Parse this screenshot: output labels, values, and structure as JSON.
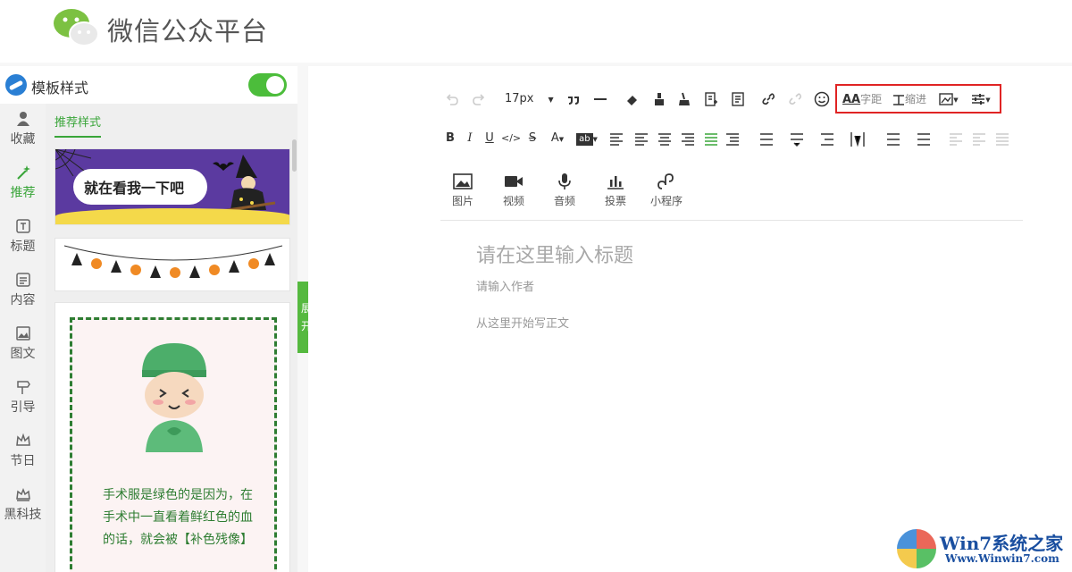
{
  "header": {
    "title": "微信公众平台"
  },
  "left_panel": {
    "title": "模板样式",
    "toggle_on": true,
    "nav": [
      {
        "label": "收藏",
        "icon": "user-icon"
      },
      {
        "label": "推荐",
        "icon": "magic-wand-icon",
        "active": true
      },
      {
        "label": "标题",
        "icon": "title-t-icon"
      },
      {
        "label": "内容",
        "icon": "content-doc-icon"
      },
      {
        "label": "图文",
        "icon": "image-text-icon"
      },
      {
        "label": "引导",
        "icon": "signpost-icon"
      },
      {
        "label": "节日",
        "icon": "crown-icon"
      },
      {
        "label": "黑科技",
        "icon": "crown-alt-icon"
      }
    ],
    "tab": "推荐样式",
    "card1_text": "就在看我一下吧",
    "card3_text": "手术服是绿色的是因为，在手术中一直看着鲜红色的血的话，就会被【补色残像】",
    "expand": "展开"
  },
  "toolbar": {
    "font_size": "17px",
    "letter_spacing": "字距",
    "indent": "缩进"
  },
  "media": [
    {
      "label": "图片",
      "icon": "image-icon"
    },
    {
      "label": "视频",
      "icon": "video-icon"
    },
    {
      "label": "音频",
      "icon": "microphone-icon"
    },
    {
      "label": "投票",
      "icon": "vote-chart-icon"
    },
    {
      "label": "小程序",
      "icon": "mini-program-icon"
    }
  ],
  "editor": {
    "title_placeholder": "请在这里输入标题",
    "author_placeholder": "请输入作者",
    "body_placeholder": "从这里开始写正文"
  },
  "watermark": {
    "title": "Win7系统之家",
    "url": "Www.Winwin7.com"
  },
  "colors": {
    "accent": "#3aa53a",
    "highlight": "#e02424"
  }
}
